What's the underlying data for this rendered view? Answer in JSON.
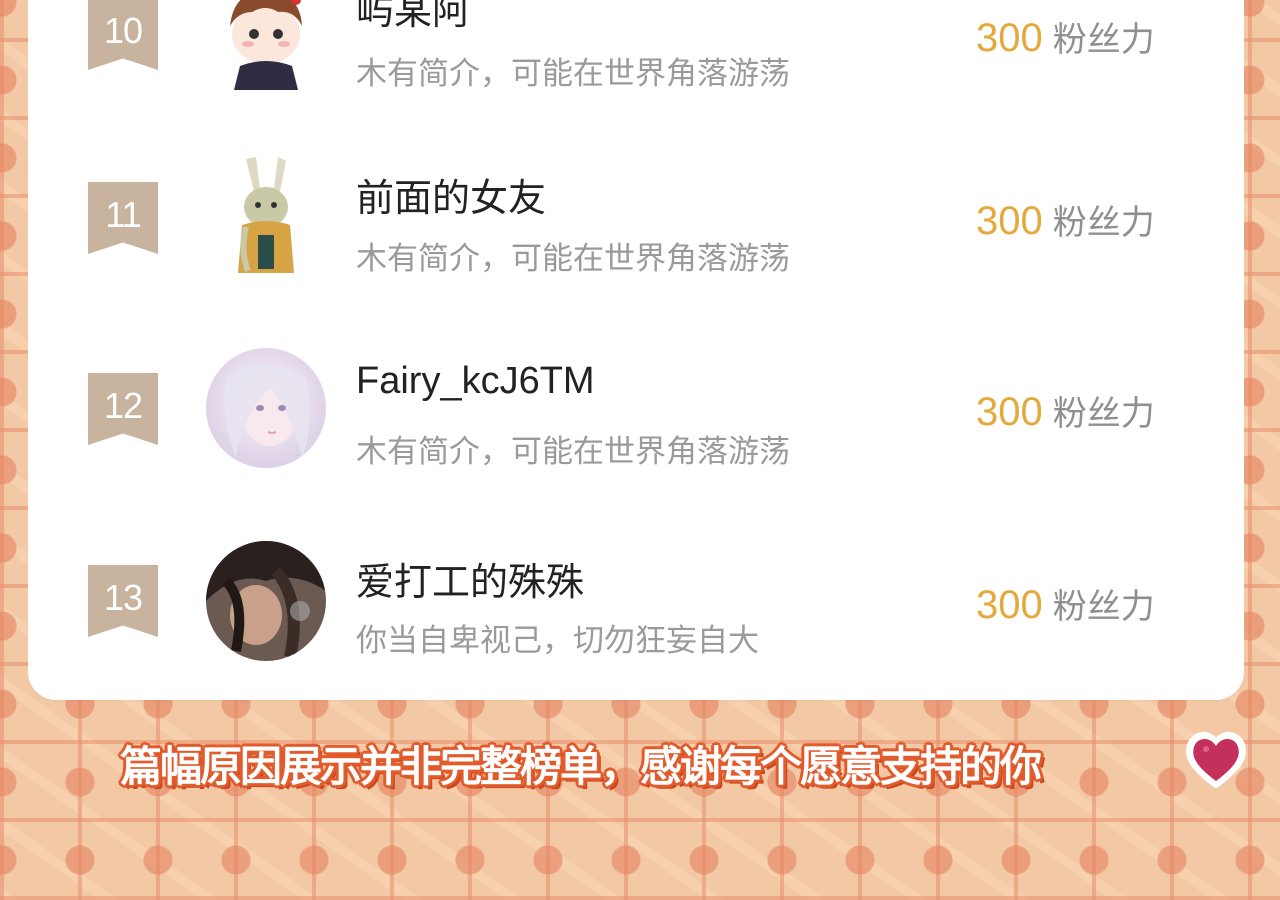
{
  "ranking": [
    {
      "rank": "10",
      "name": "屿某阿",
      "bio": "木有简介，可能在世界角落游荡",
      "score": "300",
      "unit": "粉丝力",
      "avatar": "chibi-boy-avatar"
    },
    {
      "rank": "11",
      "name": "前面的女友",
      "bio": "木有简介，可能在世界角落游荡",
      "score": "300",
      "unit": "粉丝力",
      "avatar": "rabbit-girl-avatar"
    },
    {
      "rank": "12",
      "name": "Fairy_kcJ6TM",
      "bio": "木有简介，可能在世界角落游荡",
      "score": "300",
      "unit": "粉丝力",
      "avatar": "white-hair-girl-avatar"
    },
    {
      "rank": "13",
      "name": "爱打工的殊殊",
      "bio": "你当自卑视己，切勿狂妄自大",
      "score": "300",
      "unit": "粉丝力",
      "avatar": "dark-hair-man-avatar"
    }
  ],
  "footer": {
    "text": "篇幅原因展示并非完整榜单，感谢每个愿意支持的你",
    "icon": "heart-icon"
  },
  "colors": {
    "background": "#f3c9a5",
    "rank_badge": "#c7b39e",
    "score": "#e3a93d",
    "footer_outline": "#e25b2c",
    "heart": "#c3305c"
  }
}
